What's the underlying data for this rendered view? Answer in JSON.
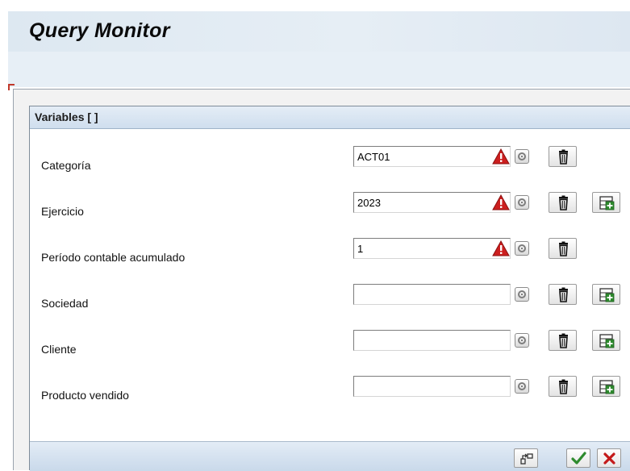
{
  "app": {
    "title": "Query Monitor"
  },
  "panel": {
    "title": "Variables [ ]"
  },
  "variables": [
    {
      "label": "Categoría",
      "value": "ACT01",
      "required": true,
      "has_add": false
    },
    {
      "label": "Ejercicio",
      "value": "2023",
      "required": true,
      "has_add": true
    },
    {
      "label": "Período contable acumulado",
      "value": "1",
      "required": true,
      "has_add": false
    },
    {
      "label": "Sociedad",
      "value": "",
      "required": false,
      "has_add": true
    },
    {
      "label": "Cliente",
      "value": "",
      "required": false,
      "has_add": true
    },
    {
      "label": "Producto vendido",
      "value": "",
      "required": false,
      "has_add": true
    }
  ],
  "icons": {
    "required": "warning-triangle-icon",
    "value_help": "value-help-icon",
    "delete": "trash-icon",
    "add": "add-row-icon",
    "footer": [
      "variant-icon",
      "checkmark-icon",
      "cancel-icon"
    ]
  },
  "colors": {
    "accent_blue": "#cfdeee",
    "warning_red": "#cc1f1f",
    "confirm_green": "#2e8b2e",
    "cancel_red": "#c41a1a"
  }
}
